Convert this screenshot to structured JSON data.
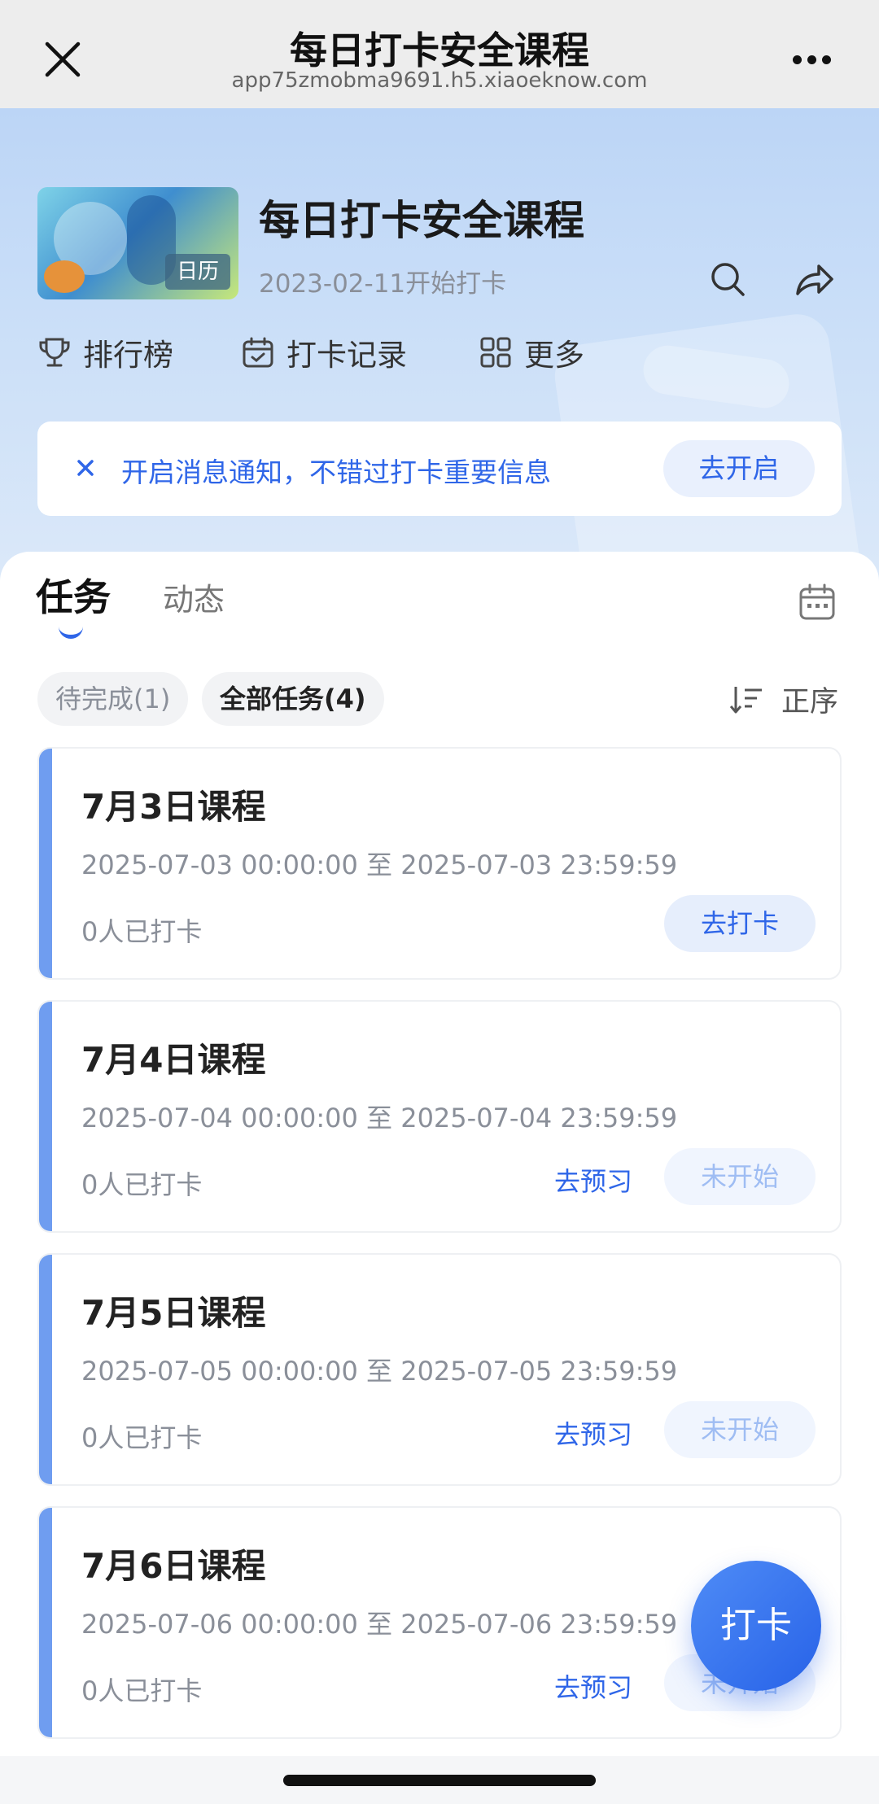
{
  "topbar": {
    "title": "每日打卡安全课程",
    "url": "app75zmobma9691.h5.xiaoeknow.com"
  },
  "hero": {
    "cover_tag": "日历",
    "course_name": "每日打卡安全课程",
    "start_text": "2023-02-11开始打卡",
    "quick_links": [
      "排行榜",
      "打卡记录",
      "更多"
    ]
  },
  "notice": {
    "text": "开启消息通知，不错过打卡重要信息",
    "button": "去开启"
  },
  "tabs": [
    "任务",
    "动态"
  ],
  "filters": [
    "待完成(1)",
    "全部任务(4)"
  ],
  "sort_label": "正序",
  "tasks": [
    {
      "title": "7月3日课程",
      "range": "2025-07-03 00:00:00 至 2025-07-03 23:59:59",
      "count": "0人已打卡",
      "action": "去打卡"
    },
    {
      "title": "7月4日课程",
      "range": "2025-07-04 00:00:00 至 2025-07-04 23:59:59",
      "count": "0人已打卡",
      "preview": "去预习",
      "status": "未开始"
    },
    {
      "title": "7月5日课程",
      "range": "2025-07-05 00:00:00 至 2025-07-05 23:59:59",
      "count": "0人已打卡",
      "preview": "去预习",
      "status": "未开始"
    },
    {
      "title": "7月6日课程",
      "range": "2025-07-06 00:00:00 至 2025-07-06 23:59:59",
      "count": "0人已打卡",
      "preview": "去预习",
      "status": "未开始"
    }
  ],
  "fab_label": "打卡",
  "colors": {
    "accent": "#2f66e8",
    "card_bar": "#6f9df0"
  }
}
